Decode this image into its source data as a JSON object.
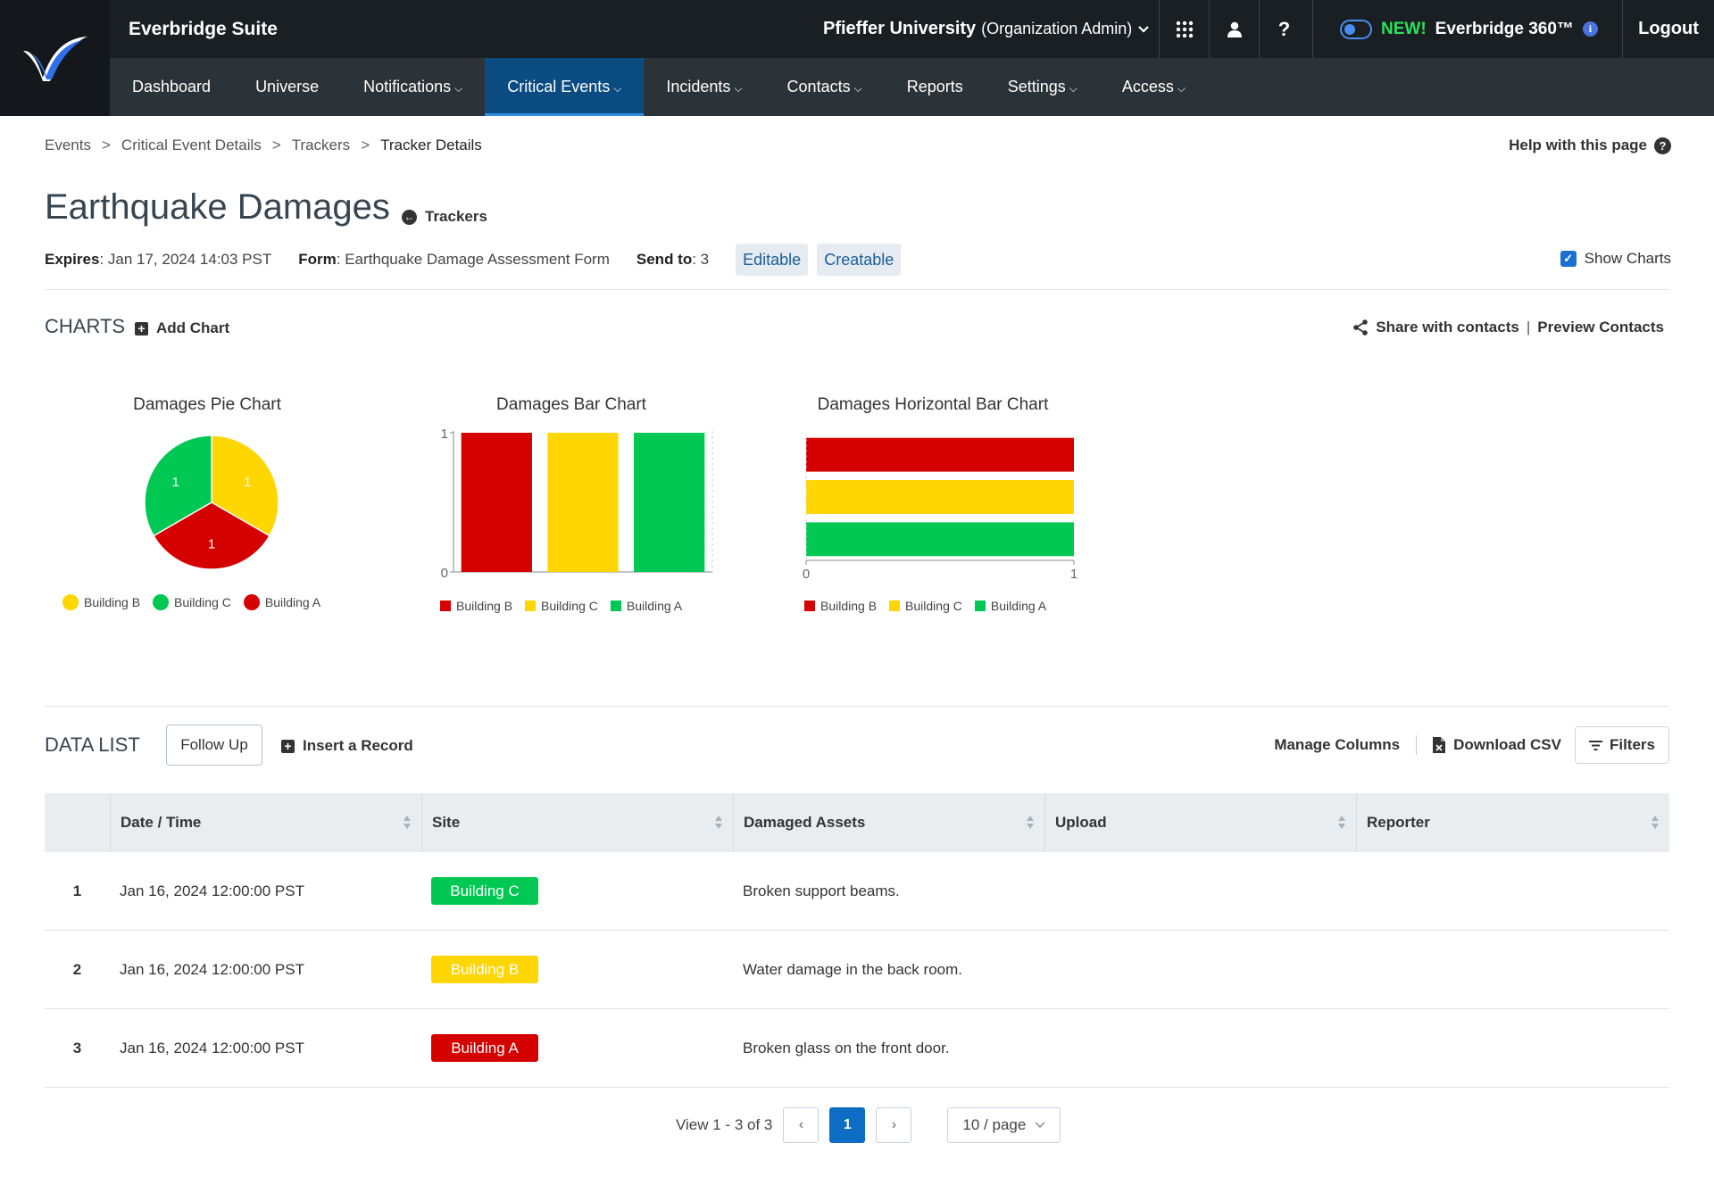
{
  "app": {
    "suite_title": "Everbridge Suite",
    "org_name": "Pfieffer University",
    "org_role": "(Organization Admin)",
    "new_badge": "NEW!",
    "e360_label": "Everbridge 360™",
    "logout_label": "Logout",
    "help_label": "?"
  },
  "nav": {
    "items": [
      {
        "label": "Dashboard"
      },
      {
        "label": "Universe"
      },
      {
        "label": "Notifications"
      },
      {
        "label": "Critical Events"
      },
      {
        "label": "Incidents"
      },
      {
        "label": "Contacts"
      },
      {
        "label": "Reports"
      },
      {
        "label": "Settings"
      },
      {
        "label": "Access"
      }
    ]
  },
  "breadcrumb": {
    "items": [
      "Events",
      "Critical Event Details",
      "Trackers",
      "Tracker Details"
    ],
    "separator": ">"
  },
  "help_link": "Help with this page",
  "page": {
    "title": "Earthquake Damages",
    "trackers_link": "Trackers",
    "expires_label": "Expires",
    "expires_value": ": Jan 17, 2024 14:03 PST",
    "form_label": "Form",
    "form_value": ": Earthquake Damage Assessment Form",
    "send_label": "Send to",
    "send_value": ": 3",
    "tags": [
      "Editable",
      "Creatable"
    ],
    "show_charts_label": "Show Charts"
  },
  "charts_section": {
    "title": "CHARTS",
    "add_chart": "Add Chart",
    "share_contacts": "Share with contacts",
    "preview_contacts": "Preview Contacts"
  },
  "colors": {
    "building_a": "#d50000",
    "building_b": "#ffd600",
    "building_c": "#00c853",
    "accent": "#0b6dc4"
  },
  "chart_data": [
    {
      "type": "pie",
      "title": "Damages Pie Chart",
      "categories": [
        "Building B",
        "Building C",
        "Building A"
      ],
      "values": [
        1,
        1,
        1
      ],
      "legend_position": "bottom"
    },
    {
      "type": "bar",
      "title": "Damages Bar Chart",
      "categories": [
        "Building B",
        "Building C",
        "Building A"
      ],
      "values": [
        1,
        1,
        1
      ],
      "ylim": [
        0,
        1
      ],
      "ticks": [
        "0",
        "1"
      ],
      "legend_position": "bottom"
    },
    {
      "type": "bar",
      "orientation": "horizontal",
      "title": "Damages Horizontal Bar Chart",
      "categories": [
        "Building B",
        "Building C",
        "Building A"
      ],
      "values": [
        1,
        1,
        1
      ],
      "xlim": [
        0,
        1
      ],
      "ticks": [
        "0",
        "1"
      ],
      "legend_position": "bottom"
    }
  ],
  "data_list": {
    "title": "DATA LIST",
    "follow_up": "Follow Up",
    "insert_record": "Insert a Record",
    "manage_columns": "Manage Columns",
    "download_csv": "Download CSV",
    "filters": "Filters",
    "columns": [
      "Date / Time",
      "Site",
      "Damaged Assets",
      "Upload",
      "Reporter"
    ],
    "rows": [
      {
        "num": "1",
        "date": "Jan 16, 2024 12:00:00 PST",
        "site": "Building C",
        "assets": "Broken support beams."
      },
      {
        "num": "2",
        "date": "Jan 16, 2024 12:00:00 PST",
        "site": "Building B",
        "assets": "Water damage in the back room."
      },
      {
        "num": "3",
        "date": "Jan 16, 2024 12:00:00 PST",
        "site": "Building A",
        "assets": "Broken glass on the front door."
      }
    ]
  },
  "pagination": {
    "view_text": "View 1 - 3 of 3",
    "current_page": "1",
    "page_size": "10 / page"
  }
}
